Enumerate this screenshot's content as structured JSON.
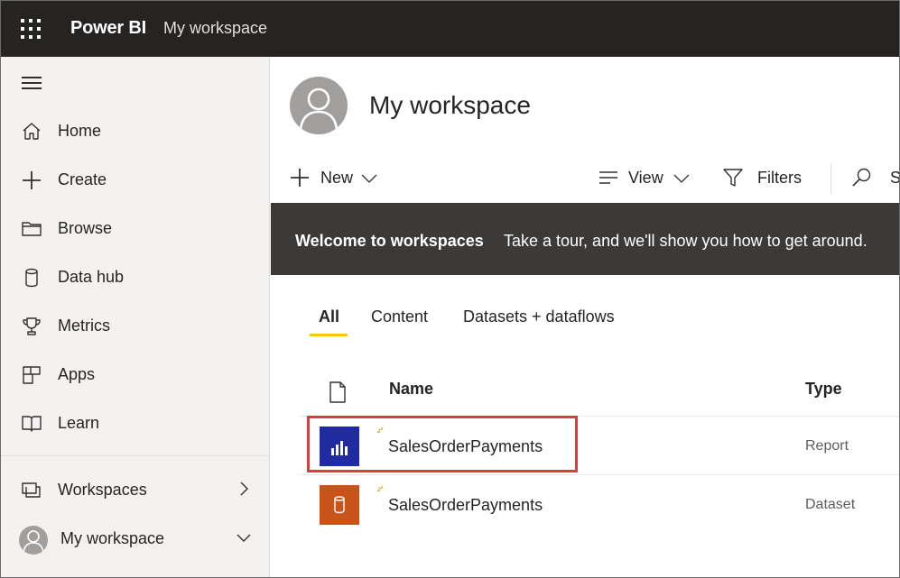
{
  "topbar": {
    "app_name": "Power BI",
    "breadcrumb": "My workspace",
    "waffle_icon": "app-launcher-icon"
  },
  "sidebar": {
    "items": [
      {
        "label": "Home",
        "icon": "home-icon"
      },
      {
        "label": "Create",
        "icon": "plus-icon"
      },
      {
        "label": "Browse",
        "icon": "folder-icon"
      },
      {
        "label": "Data hub",
        "icon": "database-icon"
      },
      {
        "label": "Metrics",
        "icon": "trophy-icon"
      },
      {
        "label": "Apps",
        "icon": "apps-icon"
      },
      {
        "label": "Learn",
        "icon": "book-icon"
      }
    ],
    "workspaces": {
      "label": "Workspaces",
      "icon": "workspaces-icon"
    },
    "my_workspace": {
      "label": "My workspace",
      "icon": "avatar"
    }
  },
  "main": {
    "title": "My workspace",
    "commands": {
      "new_label": "New",
      "view_label": "View",
      "filters_label": "Filters",
      "search_label": "S"
    },
    "banner": {
      "bold": "Welcome to workspaces",
      "text": "Take a tour, and we'll show you how to get around."
    },
    "tabs": [
      {
        "label": "All",
        "active": true
      },
      {
        "label": "Content",
        "active": false
      },
      {
        "label": "Datasets + dataflows",
        "active": false
      }
    ],
    "table": {
      "headers": {
        "name": "Name",
        "type": "Type"
      },
      "rows": [
        {
          "name": "SalesOrderPayments",
          "type": "Report",
          "icon": "report-icon",
          "color": "#1f2b9f",
          "highlighted": true
        },
        {
          "name": "SalesOrderPayments",
          "type": "Dataset",
          "icon": "dataset-icon",
          "color": "#c8541a",
          "highlighted": false
        }
      ]
    }
  },
  "colors": {
    "topbar": "#252423",
    "sidebar": "#f3f2f1",
    "banner": "#3b3a39",
    "tab_accent": "#f2c811",
    "highlight": "#e03b3b",
    "new_sparkle": "#c8a200"
  }
}
